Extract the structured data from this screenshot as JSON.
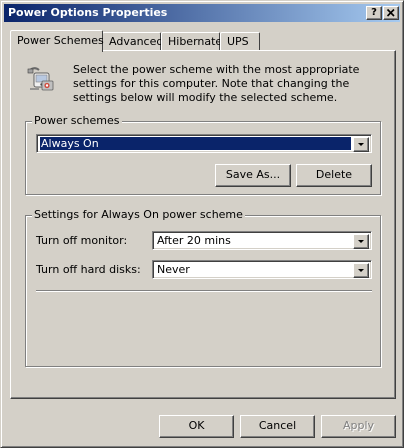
{
  "window": {
    "title": "Power Options Properties",
    "help_button": "?",
    "close_button": "X"
  },
  "tabs": [
    {
      "label": "Power Schemes",
      "active": true
    },
    {
      "label": "Advanced",
      "active": false
    },
    {
      "label": "Hibernate",
      "active": false
    },
    {
      "label": "UPS",
      "active": false
    }
  ],
  "panel": {
    "description": "Select the power scheme with the most appropriate settings for this computer. Note that changing the settings below will modify the selected scheme.",
    "schemes_group": {
      "label": "Power schemes",
      "selected_value": "Always On",
      "save_as_label": "Save As...",
      "delete_label": "Delete"
    },
    "settings_group": {
      "label": "Settings for Always On power scheme",
      "monitor_label": "Turn off monitor:",
      "monitor_value": "After 20 mins",
      "disks_label": "Turn off hard disks:",
      "disks_value": "Never"
    }
  },
  "footer": {
    "ok_label": "OK",
    "cancel_label": "Cancel",
    "apply_label": "Apply",
    "apply_enabled": false
  }
}
